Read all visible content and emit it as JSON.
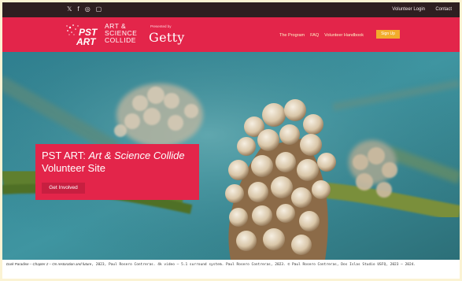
{
  "topbar": {
    "social_icons": [
      "x-icon",
      "facebook-icon",
      "instagram-icon",
      "youtube-icon"
    ],
    "social_glyphs": [
      "𝕏",
      "f",
      "◎",
      "▢"
    ],
    "volunteer_login": "Volunteer Login",
    "contact": "Contact"
  },
  "header": {
    "logo_lines": [
      "ART &",
      "SCIENCE",
      "COLLIDE"
    ],
    "presented_by": "Presented by",
    "getty": "Getty",
    "nav": {
      "program": "The Program",
      "faq": "FAQ",
      "handbook": "Volunteer Handbook"
    },
    "signup": "Sign Up"
  },
  "hero": {
    "title_plain": "PST ART: ",
    "title_italic": "Art & Science Collide",
    "title_line2": "Volunteer Site",
    "cta": "Get Involved"
  },
  "caption": {
    "italic_part": "Dark Paradise – Chapter 2 – On restoration and future",
    "mono_part": ", 2023, Paul Rosero Contreras. 4k video – 5.1 surround system. Paul Rosero Contreras, 2023. © Paul Rosero Contreras, Dos Islas Studio USFQ, 2023 – 2024."
  },
  "colors": {
    "brand_red": "#e3254a",
    "topbar_dark": "#2e1f21",
    "signup_orange": "#f2ac2c",
    "nav_cream": "#fff3c6"
  }
}
